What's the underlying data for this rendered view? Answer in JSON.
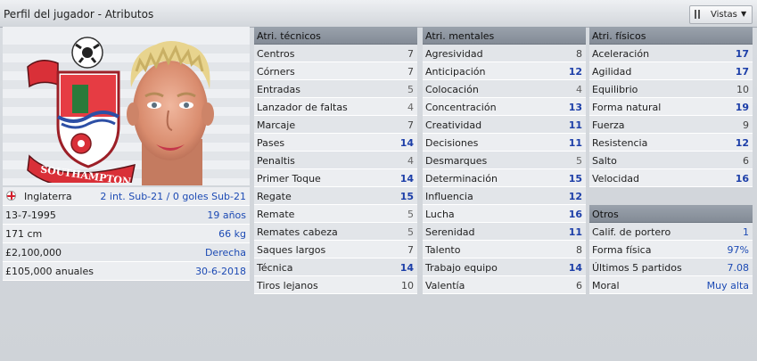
{
  "header": {
    "title": "Perfil del jugador - Atributos",
    "views_label": "Vistas"
  },
  "player": {
    "nationality": "Inglaterra",
    "caps": "2 int. Sub-21 / 0 goles Sub-21",
    "birth_date": "13-7-1995",
    "age": "19 años",
    "height": "171 cm",
    "weight": "66 kg",
    "value": "£2,100,000",
    "foot": "Derecha",
    "wage": "£105,000 anuales",
    "contract_end": "30-6-2018",
    "club_badge_text": "SOUTHAMPTON"
  },
  "technical": {
    "title": "Atri. técnicos",
    "items": [
      {
        "name": "Centros",
        "value": "7"
      },
      {
        "name": "Córners",
        "value": "7"
      },
      {
        "name": "Entradas",
        "value": "5"
      },
      {
        "name": "Lanzador de faltas",
        "value": "4"
      },
      {
        "name": "Marcaje",
        "value": "7"
      },
      {
        "name": "Pases",
        "value": "14"
      },
      {
        "name": "Penaltis",
        "value": "4"
      },
      {
        "name": "Primer Toque",
        "value": "14"
      },
      {
        "name": "Regate",
        "value": "15"
      },
      {
        "name": "Remate",
        "value": "5"
      },
      {
        "name": "Remates cabeza",
        "value": "5"
      },
      {
        "name": "Saques largos",
        "value": "7"
      },
      {
        "name": "Técnica",
        "value": "14"
      },
      {
        "name": "Tiros lejanos",
        "value": "10"
      }
    ]
  },
  "mental": {
    "title": "Atri. mentales",
    "items": [
      {
        "name": "Agresividad",
        "value": "8"
      },
      {
        "name": "Anticipación",
        "value": "12"
      },
      {
        "name": "Colocación",
        "value": "4"
      },
      {
        "name": "Concentración",
        "value": "13"
      },
      {
        "name": "Creatividad",
        "value": "11"
      },
      {
        "name": "Decisiones",
        "value": "11"
      },
      {
        "name": "Desmarques",
        "value": "5"
      },
      {
        "name": "Determinación",
        "value": "15"
      },
      {
        "name": "Influencia",
        "value": "12"
      },
      {
        "name": "Lucha",
        "value": "16"
      },
      {
        "name": "Serenidad",
        "value": "11"
      },
      {
        "name": "Talento",
        "value": "8"
      },
      {
        "name": "Trabajo equipo",
        "value": "14"
      },
      {
        "name": "Valentía",
        "value": "6"
      }
    ]
  },
  "physical": {
    "title": "Atri. físicos",
    "items": [
      {
        "name": "Aceleración",
        "value": "17"
      },
      {
        "name": "Agilidad",
        "value": "17"
      },
      {
        "name": "Equilibrio",
        "value": "10"
      },
      {
        "name": "Forma natural",
        "value": "19"
      },
      {
        "name": "Fuerza",
        "value": "9"
      },
      {
        "name": "Resistencia",
        "value": "12"
      },
      {
        "name": "Salto",
        "value": "6"
      },
      {
        "name": "Velocidad",
        "value": "16"
      }
    ]
  },
  "others": {
    "title": "Otros",
    "items": [
      {
        "name": "Calif. de portero",
        "value": "1"
      },
      {
        "name": "Forma física",
        "value": "97%"
      },
      {
        "name": "Últimos 5 partidos",
        "value": "7.08"
      },
      {
        "name": "Moral",
        "value": "Muy alta"
      }
    ]
  }
}
